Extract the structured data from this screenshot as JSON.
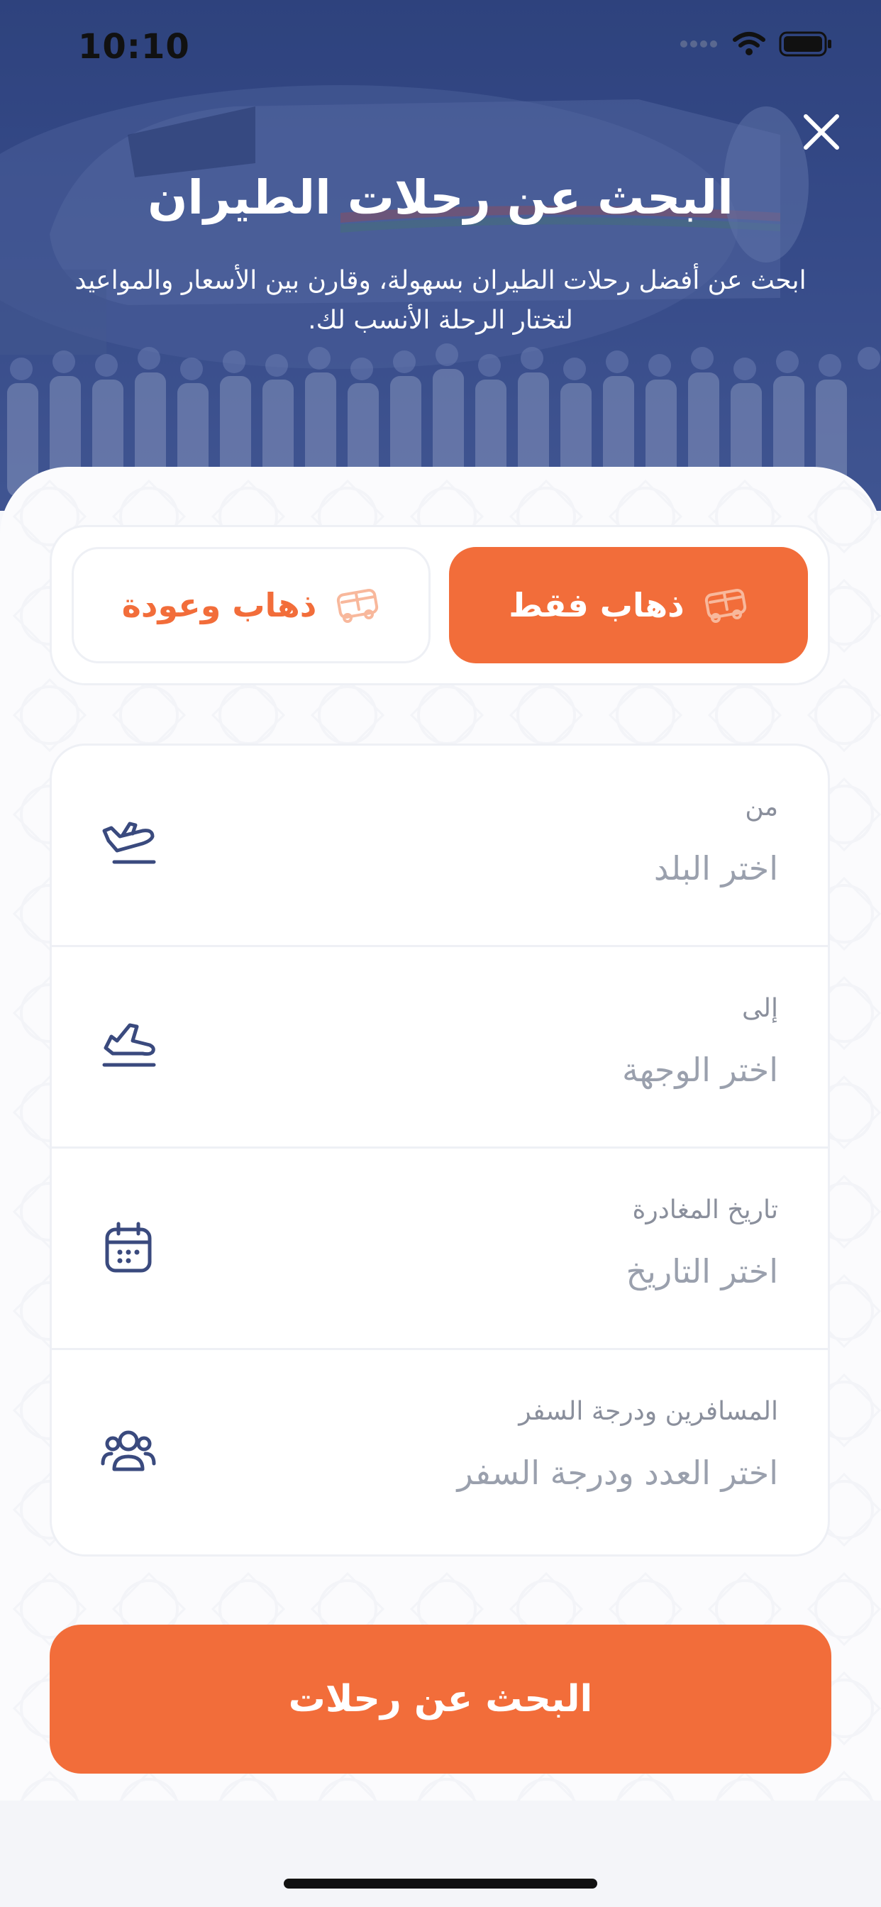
{
  "status_bar": {
    "time": "10:10"
  },
  "header": {
    "title": "البحث عن رحلات الطيران",
    "subtitle": "ابحث عن أفضل رحلات الطيران بسهولة، وقارن بين الأسعار والمواعيد لتختار الرحلة الأنسب لك."
  },
  "trip_type": {
    "selected": "one_way",
    "one_way_label": "ذهاب فقط",
    "round_trip_label": "ذهاب وعودة"
  },
  "form": {
    "from": {
      "label": "من",
      "value": "اختر البلد",
      "icon": "takeoff-icon"
    },
    "to": {
      "label": "إلى",
      "value": "اختر الوجهة",
      "icon": "landing-icon"
    },
    "departure_date": {
      "label": "تاريخ المغادرة",
      "value": "اختر التاريخ",
      "icon": "calendar-icon"
    },
    "passengers": {
      "label": "المسافرين ودرجة السفر",
      "value": "اختر العدد ودرجة السفر",
      "icon": "users-icon"
    }
  },
  "search_button": {
    "label": "البحث عن رحلات"
  },
  "colors": {
    "accent": "#f26d3a",
    "hero": "#3a4f8e",
    "icon": "#3a4a7e"
  }
}
